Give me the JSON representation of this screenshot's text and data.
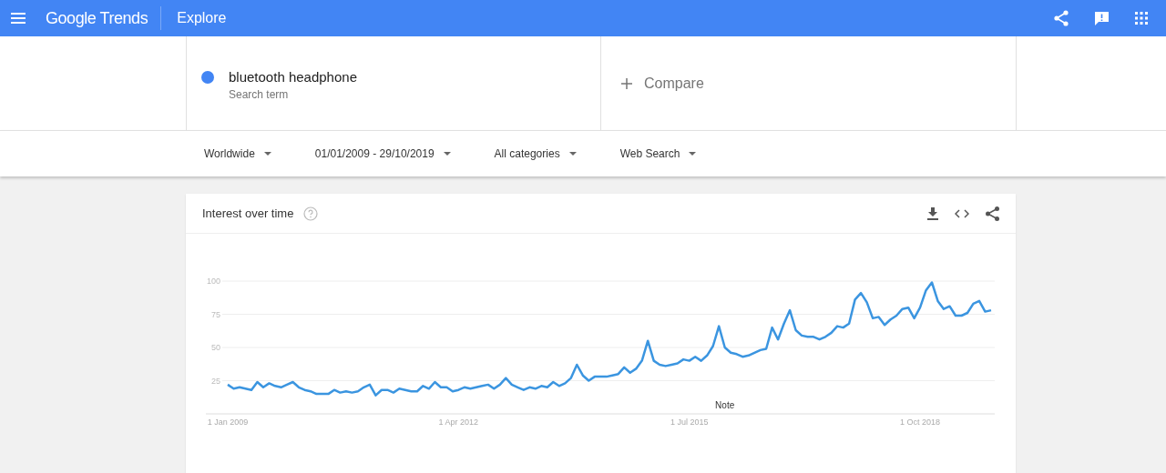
{
  "header": {
    "logo": "Google Trends",
    "section": "Explore"
  },
  "search_terms": [
    {
      "term": "bluetooth headphone",
      "subtitle": "Search term",
      "color": "#4285f4"
    }
  ],
  "compare": {
    "label": "Compare"
  },
  "filters": [
    {
      "label": "Worldwide"
    },
    {
      "label": "01/01/2009 - 29/10/2019"
    },
    {
      "label": "All categories"
    },
    {
      "label": "Web Search"
    }
  ],
  "card": {
    "title": "Interest over time",
    "chart_data": {
      "type": "line",
      "grid": true,
      "categories": [
        "1 Jan 2009",
        null,
        null,
        null,
        null,
        null,
        null,
        null,
        null,
        null,
        null,
        null,
        null,
        null,
        null,
        null,
        null,
        null,
        null,
        null,
        null,
        null,
        null,
        null,
        null,
        null,
        null,
        null,
        null,
        null,
        null,
        null,
        null,
        null,
        null,
        null,
        null,
        null,
        null,
        "1 Apr 2012",
        null,
        null,
        null,
        null,
        null,
        null,
        null,
        null,
        null,
        null,
        null,
        null,
        null,
        null,
        null,
        null,
        null,
        null,
        null,
        null,
        null,
        null,
        null,
        null,
        null,
        null,
        null,
        null,
        null,
        null,
        null,
        null,
        null,
        null,
        null,
        null,
        null,
        null,
        "1 Jul 2015",
        null,
        null,
        null,
        null,
        null,
        null,
        null,
        null,
        null,
        null,
        null,
        null,
        null,
        null,
        null,
        null,
        null,
        null,
        null,
        null,
        null,
        null,
        null,
        null,
        null,
        null,
        null,
        null,
        null,
        null,
        null,
        null,
        null,
        null,
        null,
        null,
        null,
        null,
        "1 Oct 2018",
        null,
        null,
        null,
        null,
        null,
        null,
        null,
        null,
        null,
        null,
        null,
        null
      ],
      "ylim": [
        0,
        100
      ],
      "yticks": [
        25,
        50,
        75,
        100
      ],
      "series": [
        {
          "color": "#3b95e0",
          "values": [
            22,
            19,
            20,
            19,
            18,
            24,
            20,
            23,
            21,
            20,
            22,
            24,
            20,
            18,
            17,
            15,
            15,
            15,
            18,
            16,
            17,
            16,
            17,
            20,
            22,
            14,
            18,
            18,
            16,
            19,
            18,
            17,
            17,
            21,
            19,
            24,
            20,
            20,
            17,
            18,
            20,
            19,
            20,
            21,
            22,
            19,
            22,
            27,
            22,
            20,
            18,
            20,
            19,
            21,
            20,
            24,
            21,
            23,
            27,
            37,
            29,
            25,
            28,
            28,
            28,
            29,
            30,
            35,
            31,
            34,
            40,
            55,
            40,
            37,
            36,
            37,
            38,
            41,
            40,
            43,
            40,
            44,
            51,
            66,
            50,
            46,
            45,
            43,
            44,
            46,
            48,
            49,
            65,
            56,
            68,
            78,
            63,
            59,
            58,
            58,
            56,
            58,
            61,
            66,
            65,
            68,
            86,
            91,
            84,
            72,
            73,
            67,
            71,
            74,
            79,
            80,
            72,
            80,
            93,
            99,
            85,
            79,
            81,
            74,
            74,
            76,
            83,
            85,
            77,
            78
          ]
        }
      ],
      "annotations": [
        "Note"
      ]
    }
  }
}
